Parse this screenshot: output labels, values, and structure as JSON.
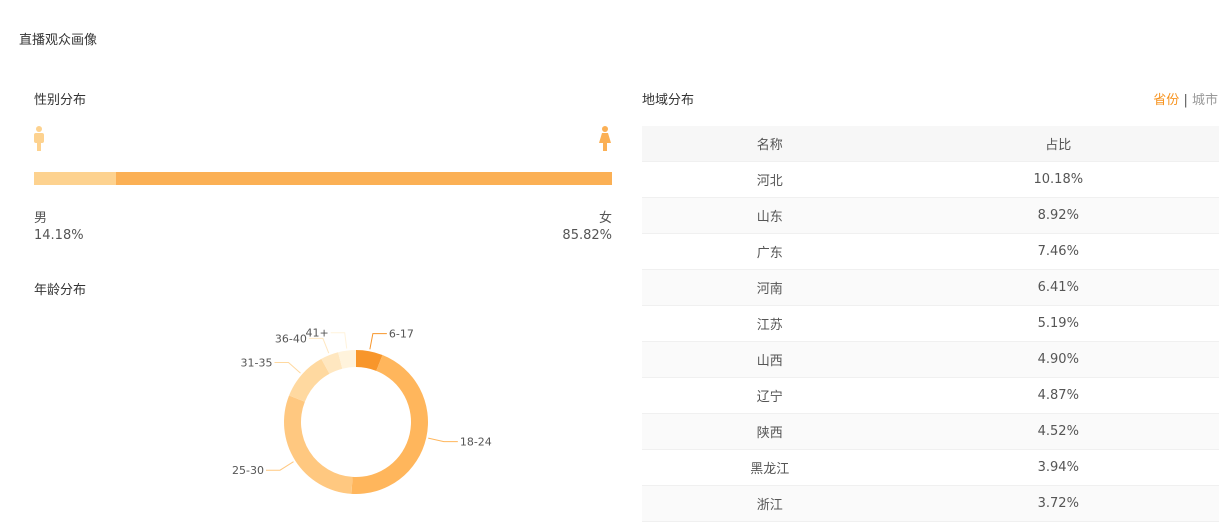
{
  "title": "直播观众画像",
  "gender": {
    "title": "性别分布",
    "male_label": "男",
    "male_value": "14.18%",
    "female_label": "女",
    "female_value": "85.82%",
    "male_percent": 14.18,
    "male_color": "#fdd28f",
    "female_color": "#fbb055",
    "icons": [
      "male-icon",
      "female-icon"
    ]
  },
  "age": {
    "title": "年龄分布"
  },
  "chart_data": {
    "type": "pie",
    "donut": true,
    "categories": [
      "6-17",
      "18-24",
      "25-30",
      "31-35",
      "36-40",
      "41+"
    ],
    "values": [
      6,
      45,
      30,
      11,
      4,
      4
    ],
    "colors": [
      "#f8962b",
      "#ffb65c",
      "#ffc880",
      "#ffd9a0",
      "#ffe7c0",
      "#fff3dc"
    ]
  },
  "region": {
    "title": "地域分布",
    "toggle": {
      "province": "省份",
      "sep": "|",
      "city": "城市"
    },
    "columns": [
      "名称",
      "占比"
    ],
    "rows": [
      [
        "河北",
        "10.18%"
      ],
      [
        "山东",
        "8.92%"
      ],
      [
        "广东",
        "7.46%"
      ],
      [
        "河南",
        "6.41%"
      ],
      [
        "江苏",
        "5.19%"
      ],
      [
        "山西",
        "4.90%"
      ],
      [
        "辽宁",
        "4.87%"
      ],
      [
        "陕西",
        "4.52%"
      ],
      [
        "黑龙江",
        "3.94%"
      ],
      [
        "浙江",
        "3.72%"
      ]
    ]
  }
}
